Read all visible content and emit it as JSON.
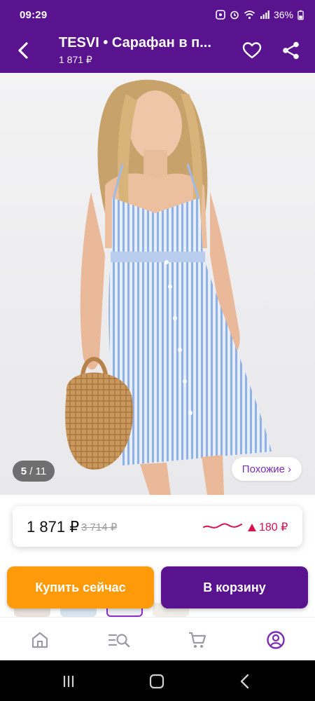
{
  "status_bar": {
    "time": "09:29",
    "battery": "36%"
  },
  "header": {
    "title": "TESVI • Сарафан в п...",
    "subtitle": "1 871 ₽"
  },
  "gallery": {
    "counter_current": "5",
    "counter_sep": " / ",
    "counter_total": "11",
    "similar_label": "Похожие ›"
  },
  "price": {
    "current": "1 871 ₽",
    "old": "3 714 ₽",
    "change": "180 ₽"
  },
  "actions": {
    "buy_now": "Купить сейчас",
    "add_to_cart": "В корзину"
  },
  "colors": {
    "brand": "#5a138f",
    "buy_now": "#ff9b0a",
    "price_drop": "#d6124f"
  },
  "icons": {
    "back": "back-arrow-icon",
    "favorite": "heart-icon",
    "share": "share-icon",
    "home": "home-icon",
    "catalog": "catalog-search-icon",
    "cart": "cart-icon",
    "profile": "profile-icon"
  }
}
